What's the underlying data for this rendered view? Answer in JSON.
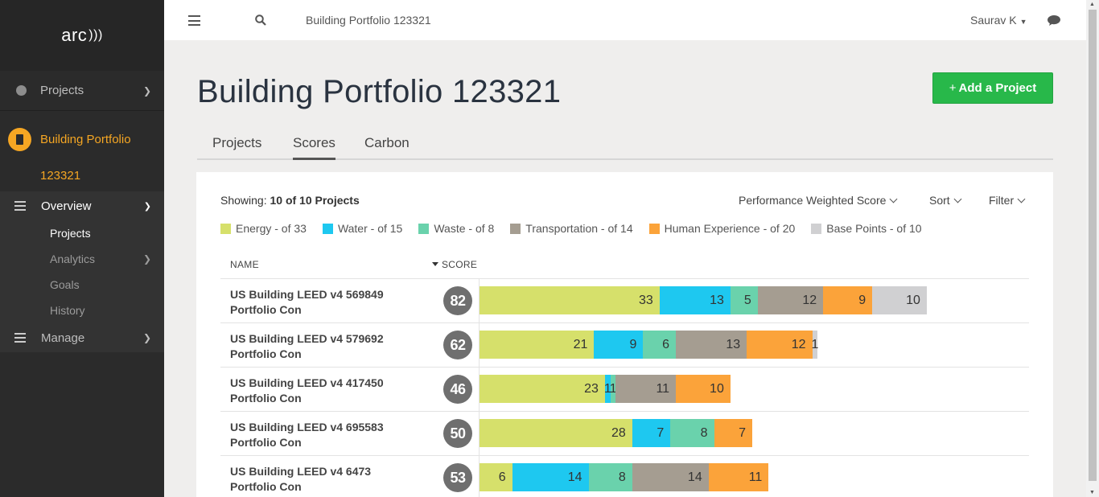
{
  "sidebar": {
    "logo_text": "arc",
    "projects_label": "Projects",
    "portfolio_name": "Building Portfolio",
    "portfolio_id": "123321",
    "overview_label": "Overview",
    "sub_items": [
      {
        "label": "Projects"
      },
      {
        "label": "Analytics"
      },
      {
        "label": "Goals"
      },
      {
        "label": "History"
      }
    ],
    "manage_label": "Manage"
  },
  "topbar": {
    "title": "Building Portfolio 123321",
    "user": "Saurav K"
  },
  "page": {
    "title": "Building Portfolio 123321",
    "add_button": "Add a Project",
    "tabs": [
      {
        "label": "Projects"
      },
      {
        "label": "Scores"
      },
      {
        "label": "Carbon"
      }
    ],
    "active_tab": "Scores"
  },
  "card": {
    "showing_prefix": "Showing:",
    "showing_value": "10 of 10 Projects",
    "metric_select": "Performance Weighted Score",
    "sort_label": "Sort",
    "filter_label": "Filter",
    "legend": [
      {
        "label": "Energy - of 33",
        "color": "#d6e06b",
        "max": 33
      },
      {
        "label": "Water - of 15",
        "color": "#1ec8f0",
        "max": 15
      },
      {
        "label": "Waste - of 8",
        "color": "#6ad2ac",
        "max": 8
      },
      {
        "label": "Transportation - of 14",
        "color": "#a59d91",
        "max": 14
      },
      {
        "label": "Human Experience - of 20",
        "color": "#fba33a",
        "max": 20
      },
      {
        "label": "Base Points - of 10",
        "color": "#d0d0d2",
        "max": 10
      }
    ],
    "col_name": "NAME",
    "col_score": "SCORE",
    "projects": [
      {
        "name1": "US Building LEED v4 569849",
        "name2": "Portfolio Con",
        "score": "82",
        "segments": [
          33,
          13,
          5,
          12,
          9,
          10
        ]
      },
      {
        "name1": "US Building LEED v4 579692",
        "name2": "Portfolio Con",
        "score": "62",
        "segments": [
          21,
          9,
          6,
          13,
          12,
          1
        ]
      },
      {
        "name1": "US Building LEED v4 417450",
        "name2": "Portfolio Con",
        "score": "46",
        "segments": [
          23,
          1,
          1,
          11,
          10,
          0
        ]
      },
      {
        "name1": "US Building LEED v4 695583",
        "name2": "Portfolio Con",
        "score": "50",
        "segments": [
          28,
          7,
          8,
          0,
          7,
          0
        ]
      },
      {
        "name1": "US Building LEED v4 6473",
        "name2": "Portfolio Con",
        "score": "53",
        "segments": [
          6,
          14,
          8,
          14,
          11,
          0
        ]
      }
    ]
  }
}
